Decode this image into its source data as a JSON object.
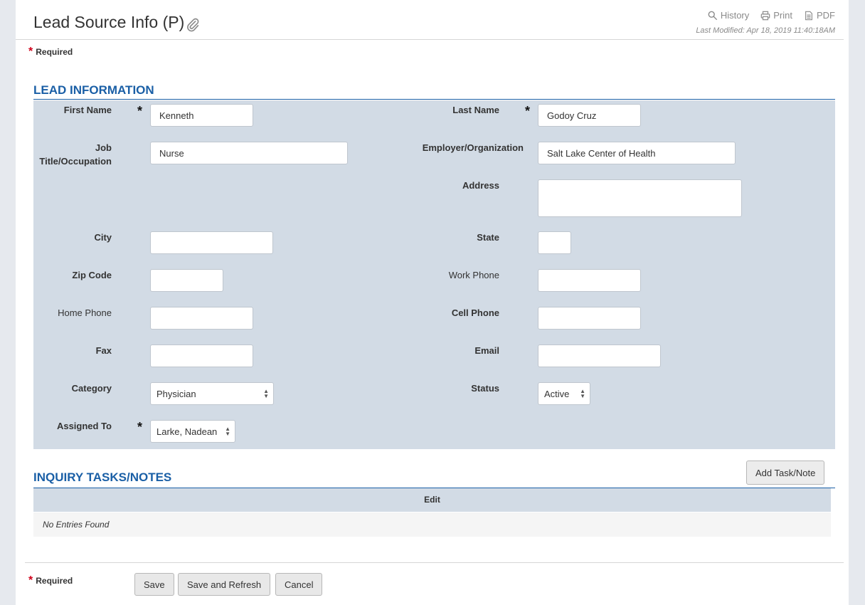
{
  "header": {
    "title": "Lead Source Info (P)",
    "actions": {
      "history": "History",
      "print": "Print",
      "pdf": "PDF"
    },
    "last_modified": "Last Modified: Apr 18, 2019 11:40:18AM"
  },
  "required_label": "Required",
  "lead_info": {
    "heading": "LEAD INFORMATION",
    "first_name": {
      "label": "First Name",
      "value": "Kenneth"
    },
    "last_name": {
      "label": "Last Name",
      "value": "Godoy Cruz"
    },
    "job_title": {
      "label_line1": "Job",
      "label_line2": "Title/Occupation",
      "value": "Nurse"
    },
    "employer": {
      "label": "Employer/Organization",
      "value": "Salt Lake Center of Health"
    },
    "address": {
      "label": "Address",
      "value": ""
    },
    "city": {
      "label": "City",
      "value": ""
    },
    "state": {
      "label": "State",
      "value": ""
    },
    "zip": {
      "label": "Zip Code",
      "value": ""
    },
    "work_phone": {
      "label": "Work Phone",
      "value": ""
    },
    "home_phone": {
      "label": "Home Phone",
      "value": ""
    },
    "cell_phone": {
      "label": "Cell Phone",
      "value": ""
    },
    "fax": {
      "label": "Fax",
      "value": ""
    },
    "email": {
      "label": "Email",
      "value": ""
    },
    "category": {
      "label": "Category",
      "value": "Physician"
    },
    "status": {
      "label": "Status",
      "value": "Active"
    },
    "assigned_to": {
      "label": "Assigned To",
      "value": "Larke, Nadean"
    }
  },
  "tasks": {
    "heading": "INQUIRY TASKS/NOTES",
    "add_button": "Add Task/Note",
    "column_edit": "Edit",
    "empty_text": "No Entries Found"
  },
  "footer": {
    "save": "Save",
    "save_refresh": "Save and Refresh",
    "cancel": "Cancel"
  },
  "colors": {
    "accent": "#1a5fa6",
    "panel": "#d2dbe5",
    "required_star": "#d0021b"
  }
}
